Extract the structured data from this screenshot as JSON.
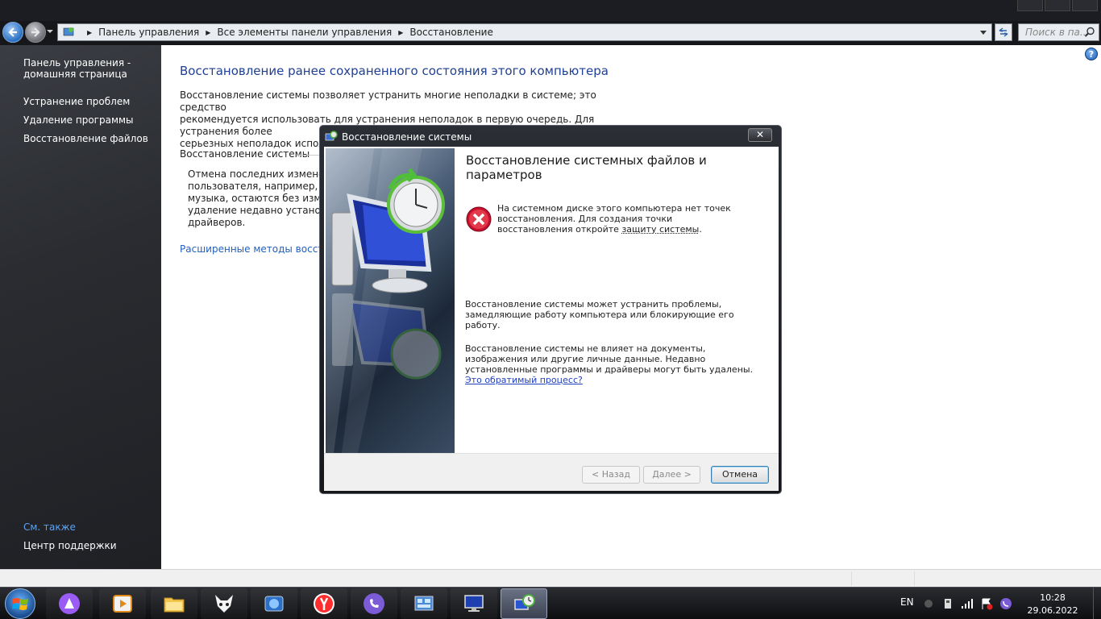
{
  "navbar": {
    "breadcrumbs": [
      "Панель управления",
      "Все элементы панели управления",
      "Восстановление"
    ],
    "search_placeholder": "Поиск в па..."
  },
  "sidebar": {
    "home_line1": "Панель управления -",
    "home_line2": "домашняя страница",
    "items": [
      {
        "label": "Устранение проблем"
      },
      {
        "label": "Удаление программы"
      },
      {
        "label": "Восстановление файлов"
      }
    ],
    "see_also": "См. также",
    "support_center": "Центр поддержки"
  },
  "main": {
    "title": "Восстановление ранее сохраненного состояния этого компьютера",
    "intro_line1": "Восстановление системы позволяет устранить многие неполадки в системе; это средство",
    "intro_line2": "рекомендуется использовать для устранения неполадок в первую очередь. Для устранения более",
    "intro_line3": "серьезных неполадок используйте дополнительные способы восстановления.",
    "section_title": "Восстановление системы",
    "section_line1": "Отмена последних изменений",
    "section_line2": "пользователя, например, док",
    "section_line3": "музыка, остаются без измене",
    "section_line4": "удаление недавно установлен",
    "section_line5": "драйверов.",
    "advanced_link": "Расширенные методы восстановления"
  },
  "dialog": {
    "title": "Восстановление системы",
    "heading": "Восстановление системных файлов и параметров",
    "error_part1": "На системном диске этого компьютера нет точек восстановления. Для создания точки восстановления откройте ",
    "error_link": "защиту системы",
    "error_part3": ".",
    "info1": "Восстановление системы может устранить проблемы, замедляющие работу компьютера или блокирующие его работу.",
    "info2_text": "Восстановление системы не влияет на документы, изображения или другие личные данные. Недавно установленные программы и драйверы могут быть удалены. ",
    "info2_link": "Это обратимый процесс?",
    "back_button": "< Назад",
    "next_button": "Далее >",
    "cancel_button": "Отмена",
    "close_glyph": "✕"
  },
  "taskbar": {
    "language": "EN",
    "time": "10:28",
    "date": "29.06.2022"
  },
  "colors": {
    "link": "#1f5fbf",
    "heading": "#1e3f93",
    "sidebar_link": "#5ea2ee"
  }
}
